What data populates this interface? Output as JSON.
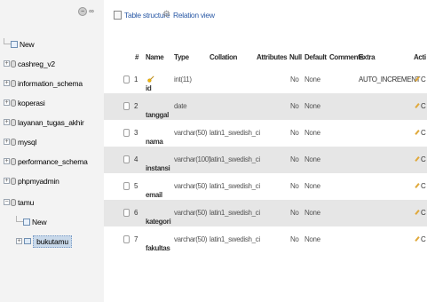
{
  "nav": {
    "tree": [
      {
        "label": "New",
        "kind": "new",
        "indent": 0
      },
      {
        "label": "cashreg_v2",
        "kind": "db",
        "indent": 0
      },
      {
        "label": "information_schema",
        "kind": "db",
        "indent": 0
      },
      {
        "label": "koperasi",
        "kind": "db",
        "indent": 0
      },
      {
        "label": "layanan_tugas_akhir",
        "kind": "db",
        "indent": 0
      },
      {
        "label": "mysql",
        "kind": "db",
        "indent": 0
      },
      {
        "label": "performance_schema",
        "kind": "db",
        "indent": 0
      },
      {
        "label": "phpmyadmin",
        "kind": "db",
        "indent": 0
      },
      {
        "label": "tamu",
        "kind": "db-open",
        "indent": 0
      },
      {
        "label": "New",
        "kind": "new",
        "indent": 1
      },
      {
        "label": "bukutamu",
        "kind": "table-selected",
        "indent": 1
      }
    ]
  },
  "tabs": {
    "structure": "Table structure",
    "relation": "Relation view"
  },
  "table": {
    "headers": {
      "num": "#",
      "name": "Name",
      "type": "Type",
      "collation": "Collation",
      "attributes": "Attributes",
      "null": "Null",
      "default": "Default",
      "comments": "Comments",
      "extra": "Extra",
      "action": "Acti"
    },
    "rows": [
      {
        "num": "1",
        "name": "id",
        "key": true,
        "type": "int(11)",
        "collation": "",
        "null": "No",
        "default": "None",
        "extra": "AUTO_INCREMENT",
        "action": "C"
      },
      {
        "num": "2",
        "name": "tanggal",
        "key": false,
        "type": "date",
        "collation": "",
        "null": "No",
        "default": "None",
        "extra": "",
        "action": "C"
      },
      {
        "num": "3",
        "name": "nama",
        "key": false,
        "type": "varchar(50)",
        "collation": "latin1_swedish_ci",
        "null": "No",
        "default": "None",
        "extra": "",
        "action": "C"
      },
      {
        "num": "4",
        "name": "instansi",
        "key": false,
        "type": "varchar(100)",
        "collation": "latin1_swedish_ci",
        "null": "No",
        "default": "None",
        "extra": "",
        "action": "C"
      },
      {
        "num": "5",
        "name": "email",
        "key": false,
        "type": "varchar(50)",
        "collation": "latin1_swedish_ci",
        "null": "No",
        "default": "None",
        "extra": "",
        "action": "C"
      },
      {
        "num": "6",
        "name": "kategori",
        "key": false,
        "type": "varchar(50)",
        "collation": "latin1_swedish_ci",
        "null": "No",
        "default": "None",
        "extra": "",
        "action": "C"
      },
      {
        "num": "7",
        "name": "fakultas",
        "key": false,
        "type": "varchar(50)",
        "collation": "latin1_swedish_ci",
        "null": "No",
        "default": "None",
        "extra": "",
        "action": "C"
      }
    ]
  }
}
